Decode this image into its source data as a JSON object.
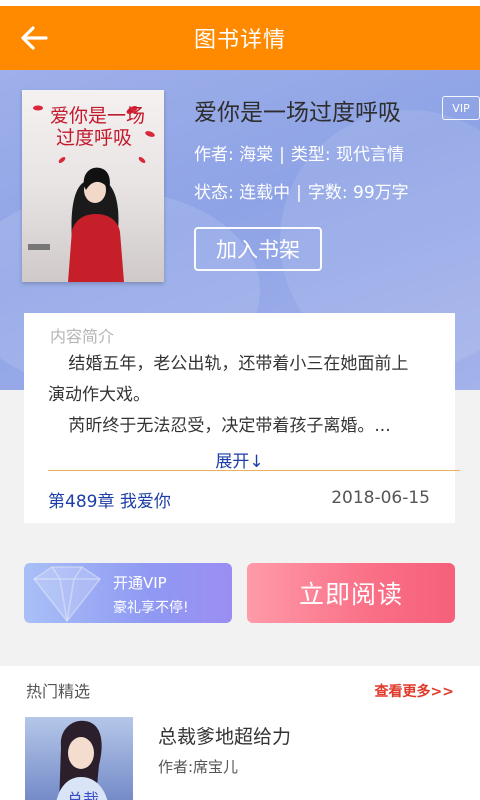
{
  "header": {
    "title": "图书详情",
    "back_icon": "arrow-left-icon"
  },
  "book": {
    "title": "爱你是一场过度呼吸",
    "vip_tag": "VIP",
    "author_label": "作者: 海棠",
    "genre_label": "类型: 现代言情",
    "status_label": "状态: 连载中",
    "wordcount_label": "字数: 99万字",
    "separator": "|",
    "add_shelf": "加入书架",
    "cover_text_line1": "爱你是一场",
    "cover_text_line2": "过度呼吸"
  },
  "intro": {
    "label": "内容简介",
    "line1": "结婚五年，老公出轨，还带着小三在她面前上",
    "line2": "演动作大戏。",
    "line3": "芮昕终于无法忍受，决定带着孩子离婚。...",
    "expand": "展开↓",
    "latest_chapter": "第489章 我爱你",
    "latest_date": "2018-06-15"
  },
  "actions": {
    "vip_line1": "开通VIP",
    "vip_line2": "豪礼享不停!",
    "read_now": "立即阅读"
  },
  "hot": {
    "title": "热门精选",
    "more": "查看更多>>",
    "item_title": "总裁爹地超给力",
    "item_author": "作者:席宝儿"
  },
  "colors": {
    "topbar": "#ff8a00",
    "link": "#1c3ea6",
    "read_btn": "#f5607a"
  }
}
